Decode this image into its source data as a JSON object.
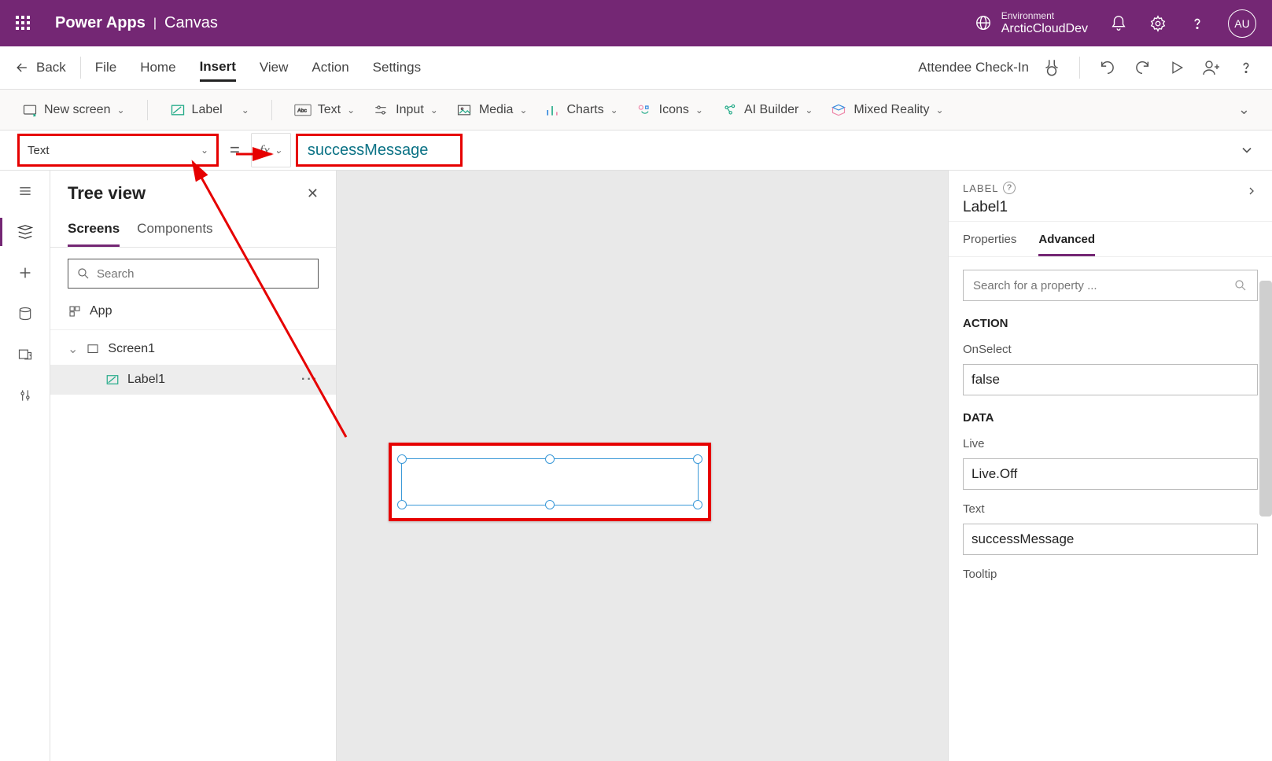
{
  "topbar": {
    "brand": "Power Apps",
    "sub": "Canvas",
    "env_label": "Environment",
    "env_name": "ArcticCloudDev",
    "avatar": "AU"
  },
  "menubar": {
    "back": "Back",
    "items": [
      "File",
      "Home",
      "Insert",
      "View",
      "Action",
      "Settings"
    ],
    "active_index": 2,
    "app_name": "Attendee Check-In"
  },
  "ribbon": {
    "new_screen": "New screen",
    "label": "Label",
    "text": "Text",
    "input": "Input",
    "media": "Media",
    "charts": "Charts",
    "icons": "Icons",
    "ai_builder": "AI Builder",
    "mixed_reality": "Mixed Reality"
  },
  "formula": {
    "property": "Text",
    "value": "successMessage"
  },
  "tree": {
    "title": "Tree view",
    "tabs": [
      "Screens",
      "Components"
    ],
    "active_tab": 0,
    "search_placeholder": "Search",
    "app_node": "App",
    "screen_node": "Screen1",
    "label_node": "Label1"
  },
  "props": {
    "type_label": "LABEL",
    "control_name": "Label1",
    "tabs": [
      "Properties",
      "Advanced"
    ],
    "active_tab": 1,
    "search_placeholder": "Search for a property ...",
    "sections": {
      "action": {
        "title": "ACTION",
        "fields": {
          "OnSelect": "false"
        }
      },
      "data": {
        "title": "DATA",
        "fields": {
          "Live": "Live.Off",
          "Text": "successMessage",
          "Tooltip": ""
        }
      }
    }
  }
}
